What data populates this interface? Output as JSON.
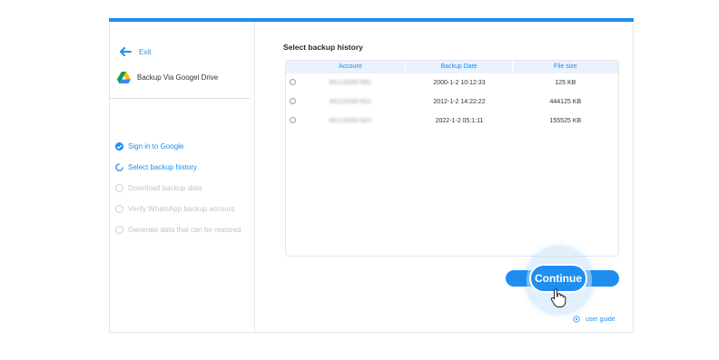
{
  "colors": {
    "accent": "#1e8ef0",
    "muted": "#c1c4c8"
  },
  "sidebar": {
    "exit_label": "Exit",
    "source_label": "Backup Via Googel Drive",
    "steps": [
      {
        "label": "Sign in to Google",
        "state": "done"
      },
      {
        "label": "Select backup history",
        "state": "active"
      },
      {
        "label": "Download backup data",
        "state": "pending"
      },
      {
        "label": "Verify WhatsApp backup account",
        "state": "pending"
      },
      {
        "label": "Generate data that can be restored",
        "state": "pending"
      }
    ]
  },
  "main": {
    "title": "Select backup history",
    "table": {
      "headers": [
        "Account",
        "Backup Date",
        "File size"
      ],
      "rows": [
        {
          "account": "861234567891",
          "date": "2000-1-2 10:12:33",
          "size": "125 KB"
        },
        {
          "account": "861234567811",
          "date": "2012-1-2 14:22:22",
          "size": "444125 KB"
        },
        {
          "account": "861234567822",
          "date": "2022-1-2 05:1:11",
          "size": "155525 KB"
        }
      ]
    },
    "continue_label": "Continue",
    "user_guide_label": "user guide"
  }
}
